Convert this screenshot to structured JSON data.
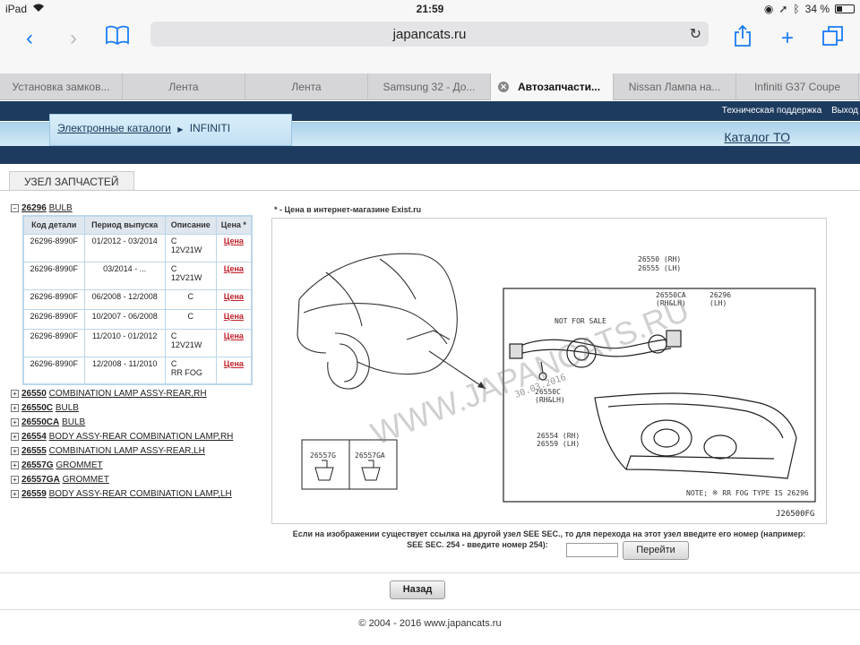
{
  "status": {
    "carrier": "iPad",
    "time": "21:59",
    "battery": "34 %",
    "battery_level": 0.34
  },
  "browser": {
    "url": "japancats.ru",
    "tabs": [
      {
        "label": "Установка замков..."
      },
      {
        "label": "Лента"
      },
      {
        "label": "Лента"
      },
      {
        "label": "Samsung 32 - До..."
      },
      {
        "label": "Автозапчасти..."
      },
      {
        "label": "Nissan Лампа на..."
      },
      {
        "label": "Infiniti G37 Coupe"
      }
    ]
  },
  "header": {
    "support": "Техническая поддержка",
    "logout": "Выход",
    "breadcrumb_root": "Электронные каталоги",
    "breadcrumb_current": "INFINITI",
    "catalog_to": "Каталог ТО"
  },
  "section_title": "УЗЕЛ ЗАПЧАСТЕЙ",
  "tree": {
    "expanded": {
      "code": "26296",
      "name": "BULB"
    },
    "columns": [
      "Код детали",
      "Период выпуска",
      "Описание",
      "Цена *"
    ],
    "rows": [
      {
        "part": "26296-8990F",
        "period": "01/2012 - 03/2014",
        "desc1": "C",
        "desc2": "12V21W",
        "price": "Цена"
      },
      {
        "part": "26296-8990F",
        "period": "03/2014 - ...",
        "desc1": "C",
        "desc2": "12V21W",
        "price": "Цена"
      },
      {
        "part": "26296-8990F",
        "period": "06/2008 - 12/2008",
        "desc1": "C",
        "desc2": "",
        "price": "Цена"
      },
      {
        "part": "26296-8990F",
        "period": "10/2007 - 06/2008",
        "desc1": "C",
        "desc2": "",
        "price": "Цена"
      },
      {
        "part": "26296-8990F",
        "period": "11/2010 - 01/2012",
        "desc1": "C",
        "desc2": "12V21W",
        "price": "Цена"
      },
      {
        "part": "26296-8990F",
        "period": "12/2008 - 11/2010",
        "desc1": "C",
        "desc2": "RR FOG",
        "price": "Цена"
      }
    ],
    "collapsed": [
      {
        "code": "26550",
        "name": "COMBINATION LAMP ASSY-REAR,RH"
      },
      {
        "code": "26550C",
        "name": "BULB"
      },
      {
        "code": "26550CA",
        "name": "BULB"
      },
      {
        "code": "26554",
        "name": "BODY ASSY-REAR COMBINATION LAMP,RH"
      },
      {
        "code": "26555",
        "name": "COMBINATION LAMP ASSY-REAR,LH"
      },
      {
        "code": "26557G",
        "name": "GROMMET"
      },
      {
        "code": "26557GA",
        "name": "GROMMET"
      },
      {
        "code": "26559",
        "name": "BODY ASSY-REAR COMBINATION LAMP,LH"
      }
    ]
  },
  "diagram": {
    "price_note": "* - Цена в интернет-магазине Exist.ru",
    "watermark": "WWW.JAPANCATS.RU",
    "date_stamp": "30.03.2016",
    "labels": {
      "l26550": "26550 (RH)",
      "l26555": "26555 (LH)",
      "l26550ca": "26550CA",
      "rhlh": "(RH&LH)",
      "l26296": "26296",
      "lh": "(LH)",
      "not_for_sale": "NOT FOR SALE",
      "l26550c": "26550C",
      "rhlh2": "(RH&LH)",
      "l26554": "26554 (RH)",
      "l26559": "26559 (LH)",
      "l26557g": "26557G",
      "l26557ga": "26557GA",
      "note": "NOTE; ※ RR FOG TYPE IS 26296",
      "fig_code": "J26500FG"
    },
    "hint_line1": "Если на изображении существует ссылка на другой узел SEE SEC., то для перехода на этот узел введите его номер (например:",
    "hint_line2": "SEE SEC. 254 - введите номер 254):",
    "goto_label": "Перейти"
  },
  "back_label": "Назад",
  "footer": "© 2004 - 2016 www.japancats.ru"
}
